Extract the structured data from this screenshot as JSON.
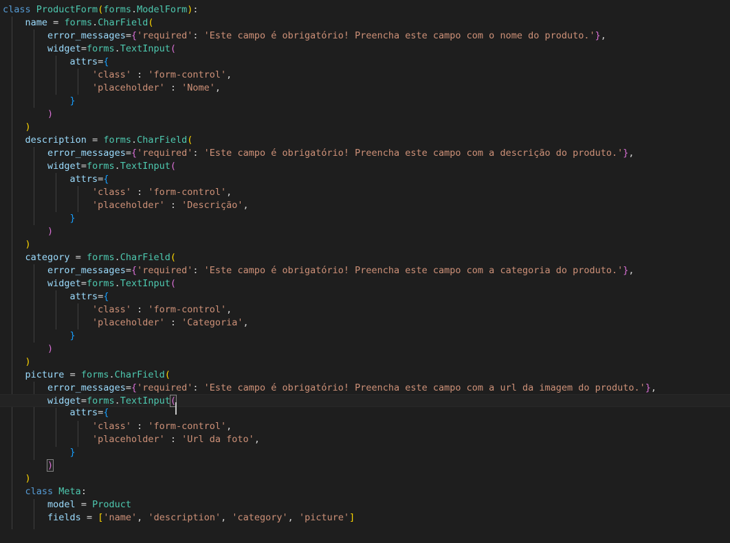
{
  "editor": {
    "language": "python",
    "theme": "dark",
    "background_color": "#1e1e1e",
    "default_text_color": "#d4d4d4",
    "cursor_line": 19,
    "cursor_column": 32,
    "colors": {
      "keyword": "#569cd6",
      "type": "#4ec9b0",
      "variable": "#9cdcfe",
      "string": "#ce9178",
      "operator": "#d4d4d4",
      "bracket_level_1": "#ffd700",
      "bracket_level_2": "#da70d6",
      "bracket_level_3": "#179fff",
      "current_line_background": "#232323",
      "indent_guide": "#404040",
      "matching_bracket_border": "#888888",
      "caret": "#c8c8c8"
    }
  },
  "code": {
    "class_name": "ProductForm",
    "base_class": "forms.ModelForm",
    "meta_class_name": "Meta",
    "meta_model": "Product",
    "meta_fields": "['name', 'description', 'category', 'picture']",
    "fields": [
      {
        "name": "name",
        "field_type": "forms.CharField",
        "error_message_required": "Este campo é obrigatório! Preencha este campo com o nome do produto.",
        "widget": "forms.TextInput",
        "attr_class": "form-control",
        "attr_placeholder": "Nome"
      },
      {
        "name": "description",
        "field_type": "forms.CharField",
        "error_message_required": "Este campo é obrigatório! Preencha este campo com a descrição do produto.",
        "widget": "forms.TextInput",
        "attr_class": "form-control",
        "attr_placeholder": "Descrição"
      },
      {
        "name": "category",
        "field_type": "forms.CharField",
        "error_message_required": "Este campo é obrigatório! Preencha este campo com a categoria do produto.",
        "widget": "forms.TextInput",
        "attr_class": "form-control",
        "attr_placeholder": "Categoria"
      },
      {
        "name": "picture",
        "field_type": "forms.CharField",
        "error_message_required": "Este campo é obrigatório! Preencha este campo com a url da imagem do produto.",
        "widget": "forms.TextInput",
        "attr_class": "form-control",
        "attr_placeholder": "Url da foto"
      }
    ]
  },
  "lines": {
    "l1_kw_class": "class",
    "l1_name": "ProductForm",
    "l1_ns": "forms",
    "l1_base": "ModelForm",
    "tok_eq": "=",
    "tok_colon": ":",
    "tok_dot": ".",
    "tok_comma": ",",
    "tok_charfield": "CharField",
    "tok_forms": "forms",
    "tok_textinput": "TextInput",
    "tok_error_messages": "error_messages",
    "tok_widget": "widget",
    "tok_attrs": "attrs",
    "tok_required": "'required'",
    "tok_class_key": "'class'",
    "tok_placeholder_key": "'placeholder'",
    "tok_model": "model",
    "tok_fields": "fields",
    "tok_meta": "Meta",
    "tok_product": "Product",
    "field_name_1": "name",
    "field_name_2": "description",
    "field_name_3": "category",
    "field_name_4": "picture",
    "msg_1": "'Este campo é obrigatório! Preencha este campo com o nome do produto.'",
    "msg_2": "'Este campo é obrigatório! Preencha este campo com a descrição do produto.'",
    "msg_3": "'Este campo é obrigatório! Preencha este campo com a categoria do produto.'",
    "msg_4": "'Este campo é obrigatório! Preencha este campo com a url da imagem do produto.'",
    "val_form_control": "'form-control'",
    "val_nome": "'Nome'",
    "val_descricao": "'Descrição'",
    "val_categoria": "'Categoria'",
    "val_url_foto": "'Url da foto'",
    "meta_fields_value": "['name', 'description', 'category', 'picture']",
    "b_open_paren": "(",
    "b_close_paren": ")",
    "b_open_brace": "{",
    "b_close_brace": "}"
  }
}
